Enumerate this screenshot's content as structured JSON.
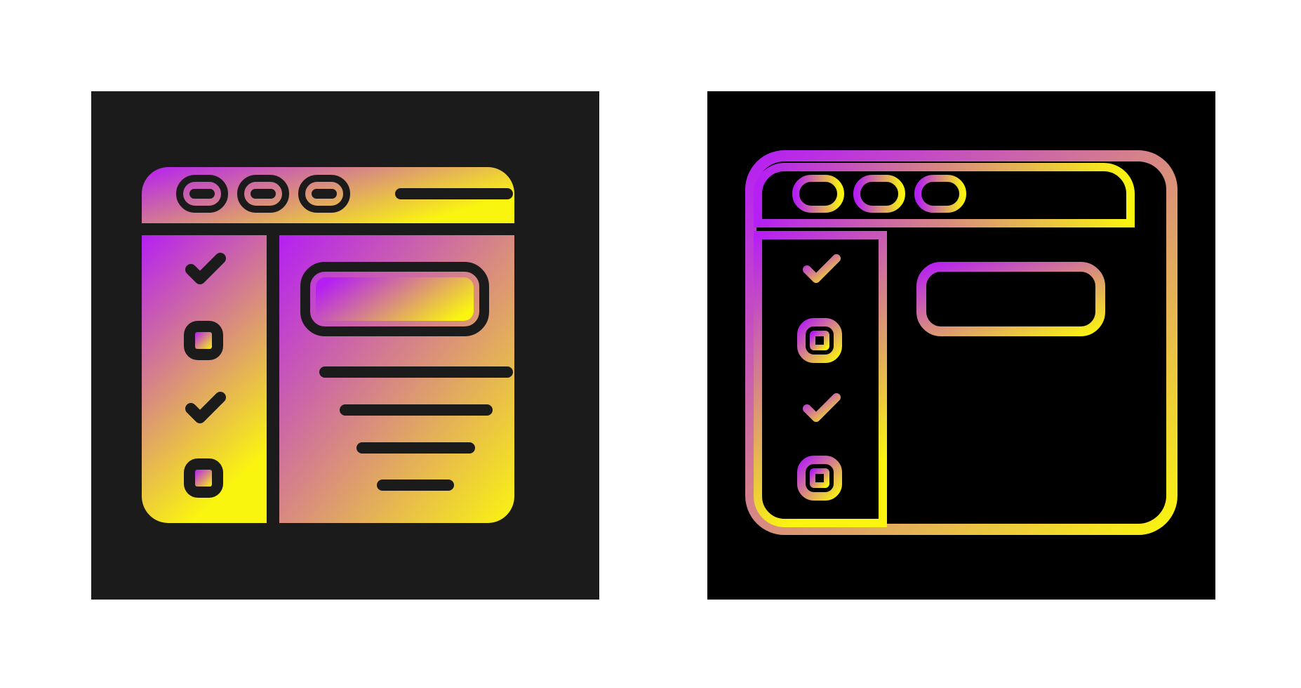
{
  "icons": [
    {
      "name": "checklist-browser-filled-icon",
      "style": "glyph",
      "background": "#1b1b1b",
      "ink": "#1b1b1b",
      "gradient": [
        "#b51ff3",
        "#faf50f"
      ]
    },
    {
      "name": "checklist-browser-outline-icon",
      "style": "outline",
      "background": "#000000",
      "gradient": [
        "#b51ff3",
        "#faf50f"
      ]
    }
  ]
}
